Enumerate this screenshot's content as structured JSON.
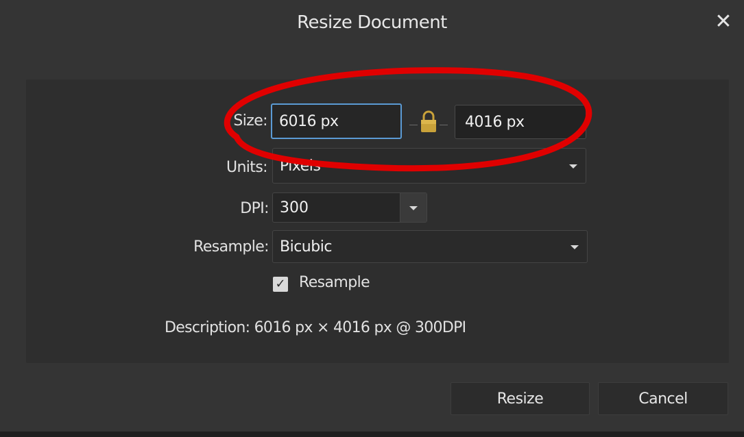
{
  "dialog": {
    "title": "Resize Document",
    "close_glyph": "✕"
  },
  "form": {
    "size_label": "Size:",
    "width_value": "6016 px",
    "height_value": "4016 px",
    "lock_icon": "lock-icon",
    "units_label": "Units:",
    "units_value": "Pixels",
    "dpi_label": "DPI:",
    "dpi_value": "300",
    "resample_label": "Resample:",
    "resample_value": "Bicubic",
    "resample_checkbox_label": "Resample",
    "resample_checked": true,
    "description": "Description: 6016 px × 4016 px @ 300DPI"
  },
  "buttons": {
    "resize": "Resize",
    "cancel": "Cancel"
  },
  "colors": {
    "background": "#343434",
    "panel": "#2e2e2e",
    "focus_border": "#5b9bd5",
    "annotation_red": "#e00000",
    "lock_gold": "#c9a23a"
  }
}
